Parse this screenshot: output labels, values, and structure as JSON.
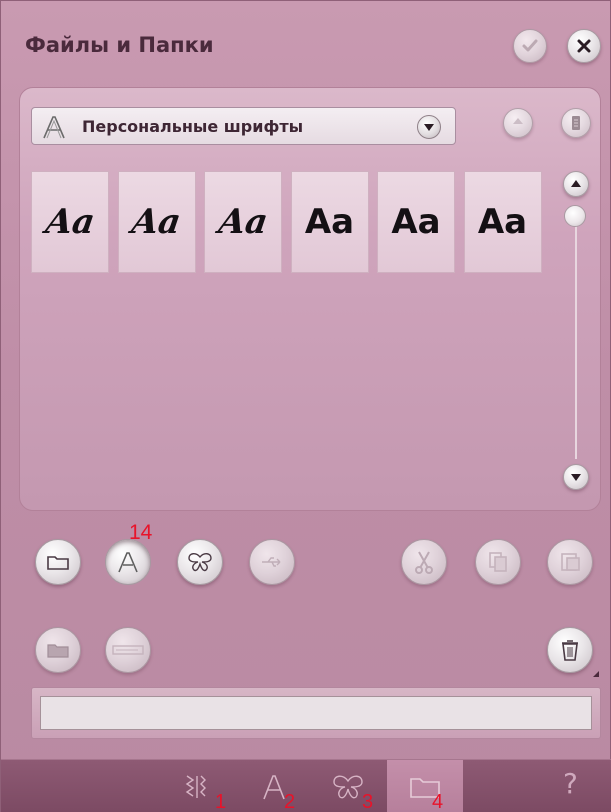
{
  "window": {
    "title": "Файлы и Папки"
  },
  "header_buttons": {
    "confirm_icon": "check-icon",
    "close_icon": "close-icon"
  },
  "font_selector": {
    "label": "Персональные шрифты",
    "icon": "letter-a-icon"
  },
  "font_tiles": [
    {
      "glyph": "Aa",
      "style": "script"
    },
    {
      "glyph": "Aa",
      "style": "script"
    },
    {
      "glyph": "Aa",
      "style": "script"
    },
    {
      "glyph": "Aa",
      "style": "sans"
    },
    {
      "glyph": "Aa",
      "style": "sans"
    },
    {
      "glyph": "Aa",
      "style": "sans"
    }
  ],
  "callouts": {
    "fonts_button": "14",
    "task1": "1",
    "task2": "2",
    "task3": "3",
    "task4": "4"
  },
  "help_label": "?",
  "colors": {
    "accent": "#e8132a",
    "title_text": "#4a2a3c",
    "taskbar": "#8e5a74"
  }
}
